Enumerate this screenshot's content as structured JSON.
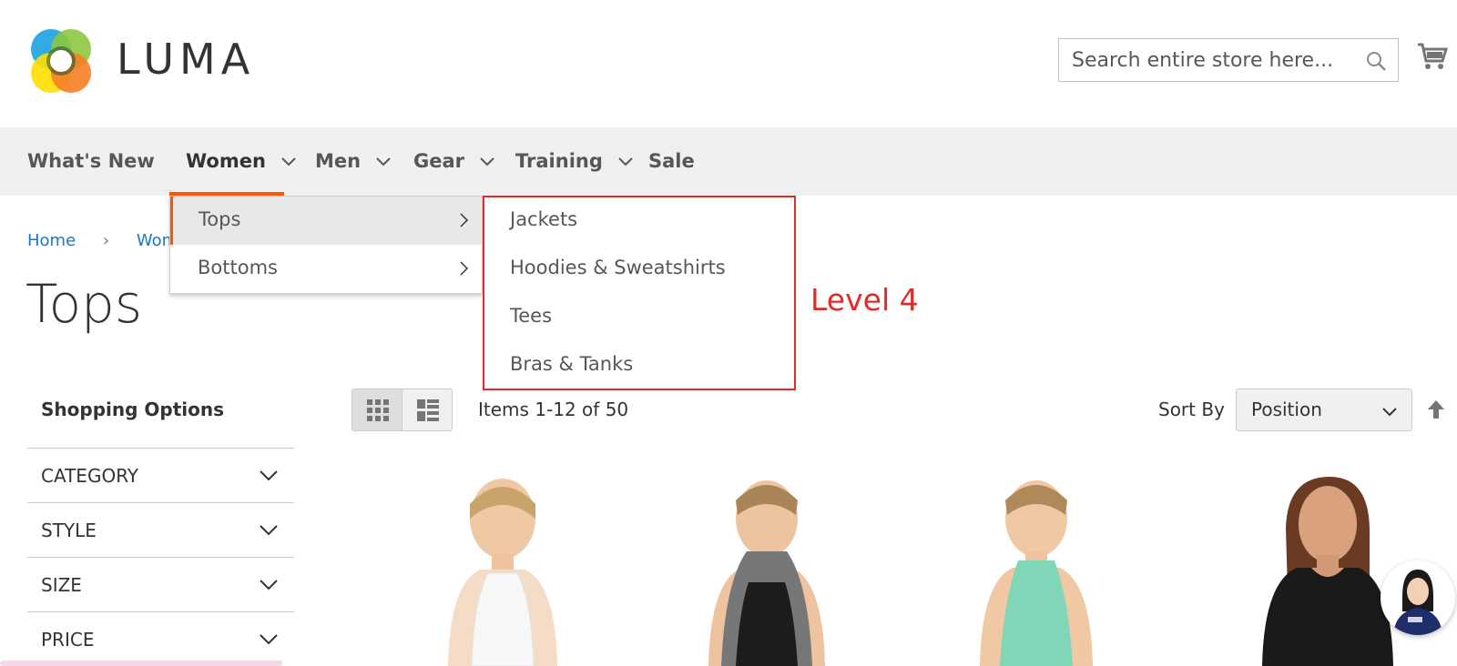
{
  "header": {
    "logo_text": "LUMA",
    "search_placeholder": "Search entire store here...",
    "cart_icon": "cart-icon"
  },
  "nav": {
    "items": [
      {
        "label": "What's New"
      },
      {
        "label": "Women"
      },
      {
        "label": "Men"
      },
      {
        "label": "Gear"
      },
      {
        "label": "Training"
      },
      {
        "label": "Sale"
      }
    ],
    "accent_color": "#ff5501"
  },
  "dropdown": {
    "items": [
      {
        "label": "Tops"
      },
      {
        "label": "Bottoms"
      }
    ]
  },
  "submenu": {
    "items": [
      {
        "label": "Jackets"
      },
      {
        "label": "Hoodies & Sweatshirts"
      },
      {
        "label": "Tees"
      },
      {
        "label": "Bras & Tanks"
      }
    ]
  },
  "annotation": {
    "text": "Level 4",
    "color": "#e02b27"
  },
  "breadcrumb": {
    "items": [
      "Home",
      "Wome"
    ]
  },
  "page_title": "Tops",
  "sidebar": {
    "title": "Shopping Options",
    "filters": [
      {
        "label": "CATEGORY"
      },
      {
        "label": "STYLE"
      },
      {
        "label": "SIZE"
      },
      {
        "label": "PRICE"
      }
    ]
  },
  "toolbar": {
    "items_count": "Items 1-12 of 50",
    "sort_label": "Sort By",
    "sort_value": "Position"
  }
}
